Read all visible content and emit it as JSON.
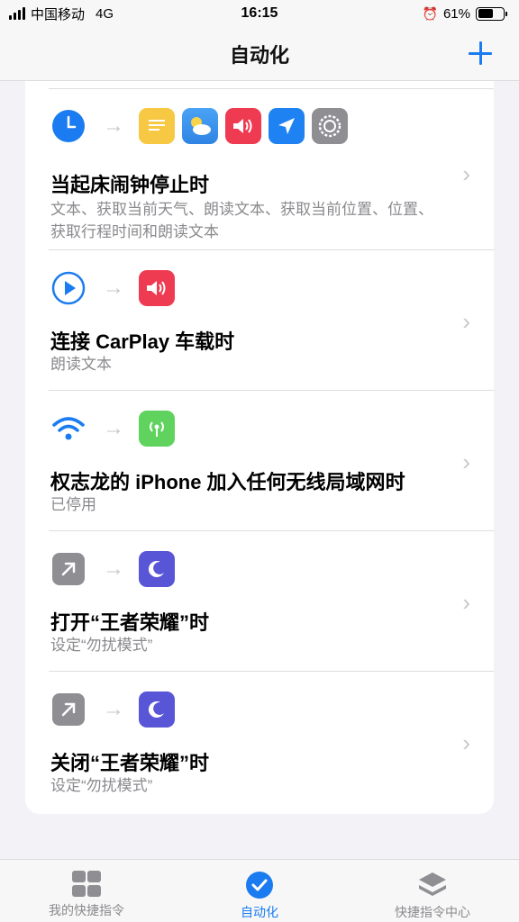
{
  "status_bar": {
    "carrier": "中国移动",
    "network": "4G",
    "time": "16:15",
    "battery": "61%",
    "battery_level": 0.61
  },
  "nav": {
    "title": "自动化"
  },
  "automations": [
    {
      "trigger_icon": "clock-icon",
      "action_icons": [
        "text-icon",
        "weather-icon",
        "speak-icon",
        "location-icon",
        "settings-icon"
      ],
      "title": "当起床闹钟停止时",
      "subtitle": "文本、获取当前天气、朗读文本、获取当前位置、位置、获取行程时间和朗读文本"
    },
    {
      "trigger_icon": "carplay-icon",
      "action_icons": [
        "speak-icon"
      ],
      "title": "连接 CarPlay 车载时",
      "subtitle": "朗读文本"
    },
    {
      "trigger_icon": "wifi-icon",
      "action_icons": [
        "cellular-icon"
      ],
      "title": "权志龙的 iPhone 加入任何无线局域网时",
      "subtitle": "已停用"
    },
    {
      "trigger_icon": "open-app-icon",
      "action_icons": [
        "moon-icon"
      ],
      "title": "打开“王者荣耀”时",
      "subtitle": "设定“勿扰模式”"
    },
    {
      "trigger_icon": "open-app-icon",
      "action_icons": [
        "moon-icon"
      ],
      "title": "关闭“王者荣耀”时",
      "subtitle": "设定“勿扰模式”"
    }
  ],
  "tabs": [
    {
      "label": "我的快捷指令",
      "active": false
    },
    {
      "label": "自动化",
      "active": true
    },
    {
      "label": "快捷指令中心",
      "active": false
    }
  ],
  "colors": {
    "accent": "#1a7cf0",
    "text_yellow": "#f7c843",
    "speak_red": "#ee3b52",
    "location_blue": "#1f82f2",
    "settings_gray": "#8e8e93",
    "green": "#5fd35e",
    "moon_purple": "#5855d6",
    "open_app_gray": "#8e8e93"
  }
}
